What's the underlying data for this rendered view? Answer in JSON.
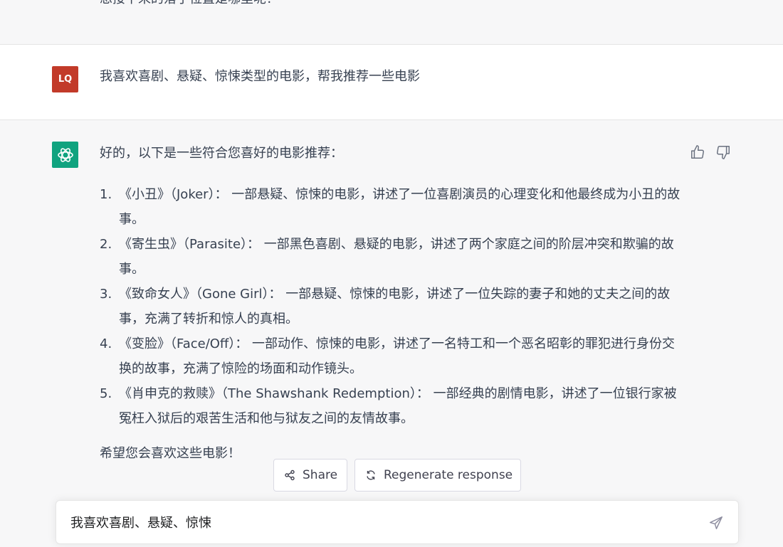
{
  "previous_message": {
    "text": "想接下来的落子位置是哪里呢？"
  },
  "user_message": {
    "avatar_initials": "LQ",
    "text": "我喜欢喜剧、悬疑、惊悚类型的电影，帮我推荐一些电影"
  },
  "assistant_message": {
    "avatar_icon": "openai-logo-icon",
    "intro": "好的，以下是一些符合您喜好的电影推荐：",
    "items": [
      {
        "num": "1.",
        "text": "《小丑》（Joker）： 一部悬疑、惊悚的电影，讲述了一位喜剧演员的心理变化和他最终成为小丑的故事。"
      },
      {
        "num": "2.",
        "text": "《寄生虫》（Parasite）： 一部黑色喜剧、悬疑的电影，讲述了两个家庭之间的阶层冲突和欺骗的故事。"
      },
      {
        "num": "3.",
        "text": "《致命女人》（Gone Girl）： 一部悬疑、惊悚的电影，讲述了一位失踪的妻子和她的丈夫之间的故事，充满了转折和惊人的真相。"
      },
      {
        "num": "4.",
        "text": "《变脸》（Face/Off）： 一部动作、惊悚的电影，讲述了一名特工和一个恶名昭彰的罪犯进行身份交换的故事，充满了惊险的场面和动作镜头。"
      },
      {
        "num": "5.",
        "text": "《肖申克的救赎》（The Shawshank Redemption）： 一部经典的剧情电影，讲述了一位银行家被冤枉入狱后的艰苦生活和他与狱友之间的友情故事。"
      }
    ],
    "outro": "希望您会喜欢这些电影！",
    "feedback_icons": [
      "thumbs-up-icon",
      "thumbs-down-icon"
    ]
  },
  "actions": {
    "share_label": "Share",
    "regenerate_label": "Regenerate response"
  },
  "composer": {
    "value": "我喜欢喜剧、悬疑、惊悚",
    "send_icon": "send-icon"
  },
  "colors": {
    "user_avatar": "#c23a29",
    "assistant_avatar": "#10a37f",
    "assistant_bg": "#f7f7f8"
  }
}
